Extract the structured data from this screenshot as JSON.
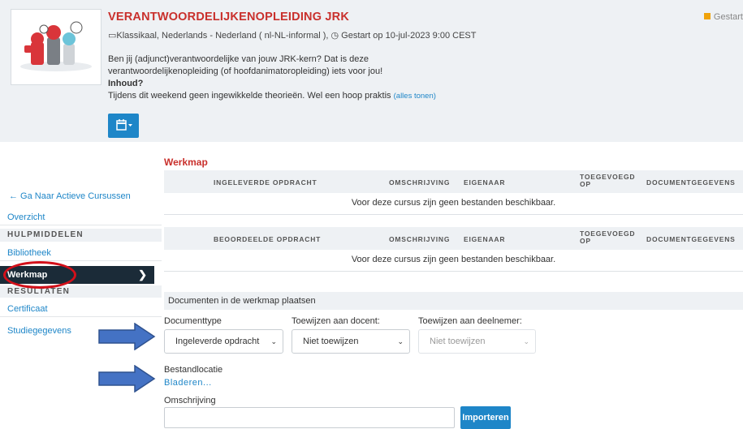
{
  "course": {
    "title": "VERANTWOORDELIJKENOPLEIDING JRK",
    "meta_text": "Klassikaal, Nederlands - Nederland ( nl-NL-informal ), ◷ Gestart op 10-jul-2023 9:00 CEST",
    "status": "Gestart",
    "description_lines": [
      "Ben jij (adjunct)verantwoordelijke van jouw JRK-kern? Dat is deze",
      "verantwoordelijkenopleiding (of hoofdanimatoropleiding) iets voor jou!",
      "Inhoud?",
      "Tijdens dit weekend geen ingewikkelde theorieën. Wel een hoop praktis"
    ],
    "show_all": "(alles tonen)",
    "calendar_icon": "calendar-icon",
    "colors": {
      "accent": "#1e86c8",
      "title": "#c9302c",
      "status": "#f0a30a"
    }
  },
  "sidebar": {
    "back": "← Ga Naar Actieve Cursussen",
    "overzicht": "Overzicht",
    "hulpmiddelen": "HULPMIDDELEN",
    "bibliotheek": "Bibliotheek",
    "werkmap": "Werkmap",
    "resultaten": "RESULTATEN",
    "certificaat": "Certificaat",
    "studiegegevens": "Studiegegevens",
    "active_bg": "#1b2b38",
    "highlight_color": "#d3101a"
  },
  "main": {
    "title": "Werkmap",
    "table1": {
      "col1": "INGELEVERDE OPDRACHT",
      "col2": "OMSCHRIJVING",
      "col3": "EIGENAAR",
      "col4": "TOEGEVOEGD OP",
      "col5": "DOCUMENTGEGEVENS",
      "empty": "Voor deze cursus zijn geen bestanden beschikbaar."
    },
    "table2": {
      "col1": "BEOORDEELDE OPDRACHT",
      "col2": "OMSCHRIJVING",
      "col3": "EIGENAAR",
      "col4": "TOEGEVOEGD OP",
      "col5": "DOCUMENTGEGEVENS",
      "empty": "Voor deze cursus zijn geen bestanden beschikbaar."
    },
    "upload": {
      "header": "Documenten in de werkmap plaatsen",
      "doctype_label": "Documenttype",
      "doctype_value": "Ingeleverde opdracht",
      "docent_label": "Toewijzen aan docent:",
      "docent_value": "Niet toewijzen",
      "deelnemer_label": "Toewijzen aan deelnemer:",
      "deelnemer_value": "Niet toewijzen",
      "location_label": "Bestandlocatie",
      "browse": "Bladeren...",
      "description_label": "Omschrijving",
      "import_button": "Importeren"
    }
  },
  "annotations": {
    "arrow_color": "#4472c4"
  }
}
